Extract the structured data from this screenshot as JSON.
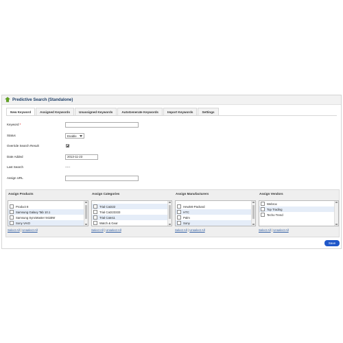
{
  "header": {
    "title": "Predictive Search (Standalone)",
    "icon": "puzzle-icon",
    "icon_color": "#62a51f"
  },
  "tabs": [
    {
      "label": "New Keyword",
      "active": true
    },
    {
      "label": "Assigned Keywords"
    },
    {
      "label": "Unassigned Keywords"
    },
    {
      "label": "AutoGenerate Keywords"
    },
    {
      "label": "Import Keywords"
    },
    {
      "label": "Settings"
    }
  ],
  "form": {
    "keyword_label": "Keyword",
    "required_mark": "*",
    "keyword_value": "",
    "status_label": "Status",
    "status_value": "Enable",
    "override_label": "Override Search Result",
    "override_checked": true,
    "date_label": "Date Added",
    "date_value": "2013-11-23",
    "last_search_label": "Last Search",
    "last_search_value": "-----",
    "assign_url_label": "Assign URL",
    "assign_url_value": ""
  },
  "assign": {
    "select_all": "Select All",
    "separator": "|",
    "unselect_all": "Unselect All",
    "products": {
      "title": "Assign Products",
      "items": [
        "Product 8",
        "Samsung Galaxy Tab 10.1",
        "Samsung SyncMaster 941BW",
        "Sony VAIO"
      ]
    },
    "categories": {
      "title": "Assign Categories",
      "items": [
        "Trial Cat222",
        "Trial Cat223333",
        "Trial Cate11",
        "Watch & Gear"
      ]
    },
    "manufacturers": {
      "title": "Assign Manufacturers",
      "items": [
        "Hewlett-Packard",
        "HTC",
        "Palm",
        "Sony"
      ]
    },
    "vendors": {
      "title": "Assign Vendors",
      "items": [
        "Webrox",
        "Top Trading",
        "Techo Trend"
      ]
    }
  },
  "actions": {
    "save_label": "Save"
  },
  "colors": {
    "accent": "#1f57c9",
    "title": "#1f3f67",
    "link": "#2c5aa0"
  }
}
